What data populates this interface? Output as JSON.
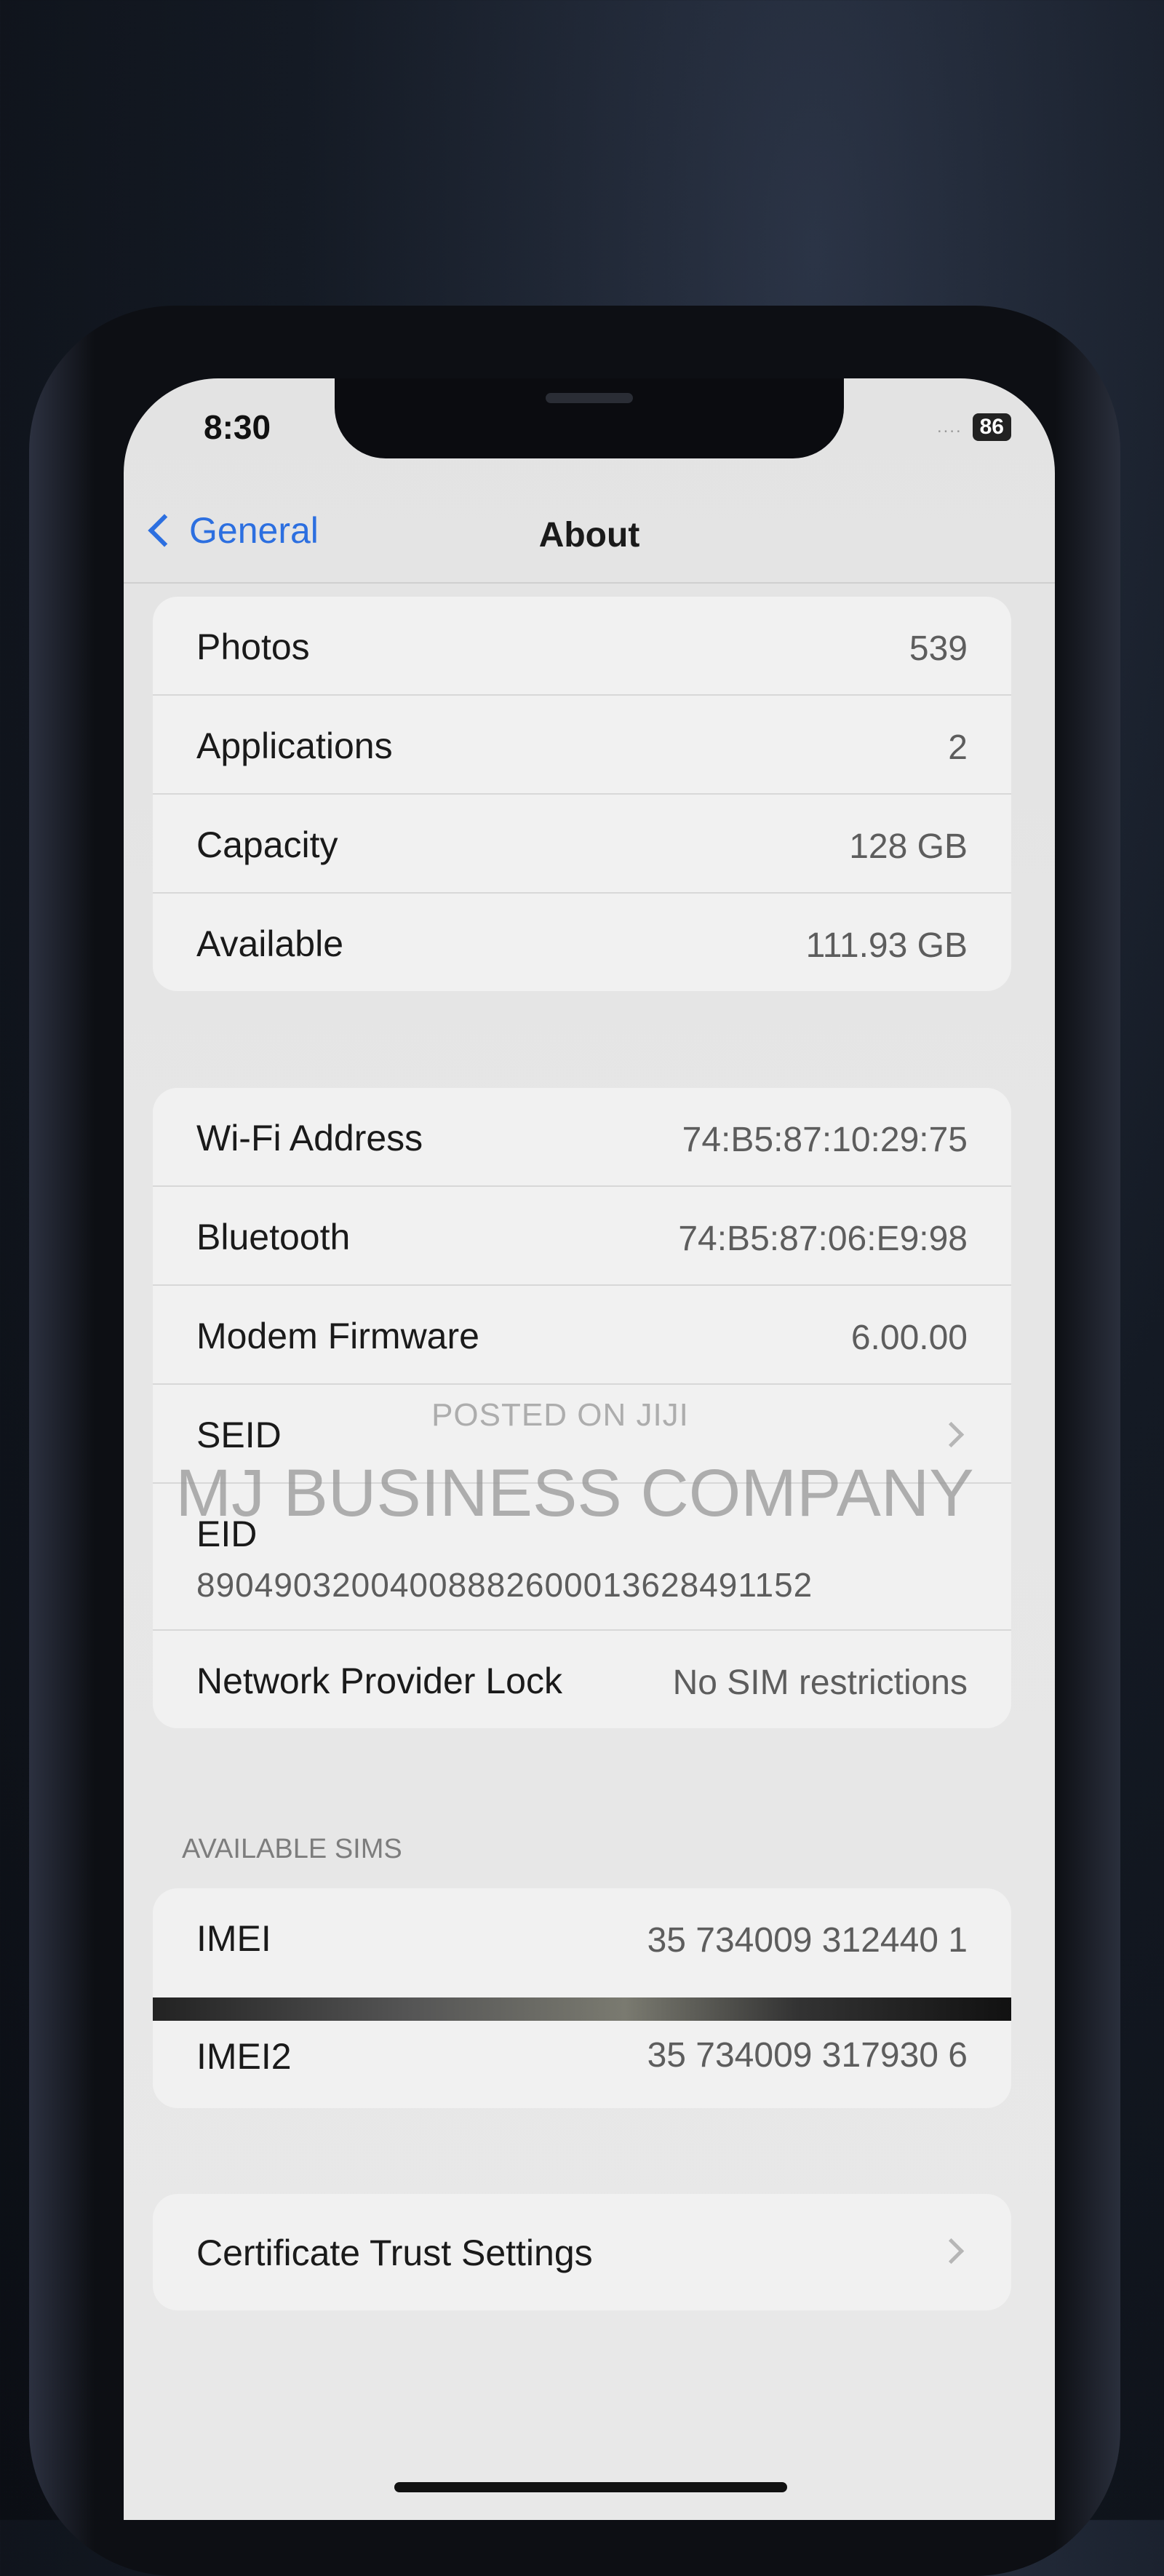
{
  "status_bar": {
    "time": "8:30",
    "signal": "....",
    "battery": "86"
  },
  "navigation": {
    "back_label": "General",
    "title": "About"
  },
  "storage_group": [
    {
      "label": "Photos",
      "value": "539"
    },
    {
      "label": "Applications",
      "value": "2"
    },
    {
      "label": "Capacity",
      "value": "128 GB"
    },
    {
      "label": "Available",
      "value": "111.93 GB"
    }
  ],
  "network_group": {
    "wifi": {
      "label": "Wi-Fi Address",
      "value": "74:B5:87:10:29:75"
    },
    "bluetooth": {
      "label": "Bluetooth",
      "value": "74:B5:87:06:E9:98"
    },
    "modem": {
      "label": "Modem Firmware",
      "value": "6.00.00"
    },
    "seid": {
      "label": "SEID"
    },
    "eid": {
      "label": "EID",
      "value": "89049032004008882600013628491152"
    },
    "lock": {
      "label": "Network Provider Lock",
      "value": "No SIM restrictions"
    }
  },
  "sims": {
    "header": "AVAILABLE SIMS",
    "imei1": {
      "label": "IMEI",
      "value": "35 734009 312440 1"
    },
    "imei2": {
      "label": "IMEI2",
      "value": "35 734009 317930 6"
    }
  },
  "certificate": {
    "label": "Certificate Trust Settings"
  },
  "watermark": {
    "line1": "POSTED ON JIJI",
    "line2": "MJ BUSINESS COMPANY"
  }
}
